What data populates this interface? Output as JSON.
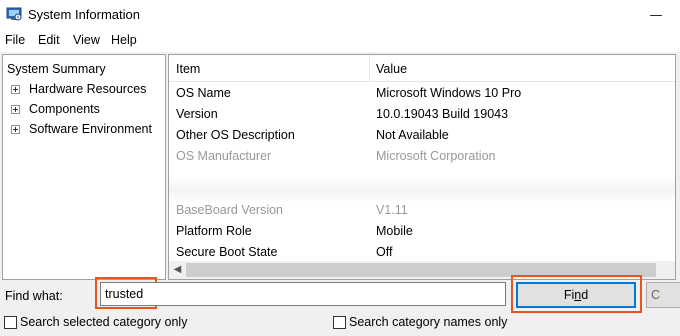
{
  "window": {
    "title": "System Information",
    "icon": "system-info-icon",
    "accent": "#0078d7",
    "highlight": "#e8561b"
  },
  "menu": [
    "File",
    "Edit",
    "View",
    "Help"
  ],
  "tree": {
    "selected": "System Summary",
    "items": [
      "Hardware Resources",
      "Components",
      "Software Environment"
    ]
  },
  "list": {
    "headers": [
      "Item",
      "Value"
    ],
    "rows": [
      {
        "item": "OS Name",
        "value": "Microsoft Windows 10 Pro"
      },
      {
        "item": "Version",
        "value": "10.0.19043 Build 19043"
      },
      {
        "item": "Other OS Description",
        "value": "Not Available"
      },
      {
        "item": "OS Manufacturer",
        "value": "Microsoft Corporation"
      },
      {
        "item": "BaseBoard Version",
        "value": "V1.11"
      },
      {
        "item": "Platform Role",
        "value": "Mobile"
      },
      {
        "item": "Secure Boot State",
        "value": "Off"
      }
    ]
  },
  "find": {
    "label": "Find what:",
    "value": "trusted",
    "button_pre": "Fi",
    "button_key": "n",
    "button_post": "d",
    "close_label": "C"
  },
  "options": {
    "selected_category": "Search selected category only",
    "category_names": "Search category names only"
  }
}
